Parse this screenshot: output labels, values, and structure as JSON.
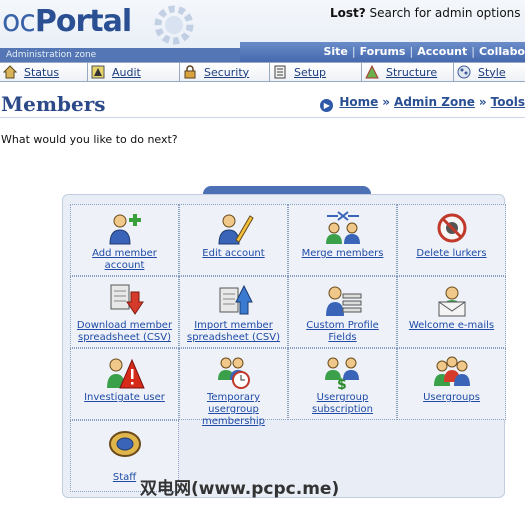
{
  "header": {
    "logo_oc": "oc",
    "logo_portal": "Portal",
    "zone_label": "Administration zone",
    "lost_prefix": "Lost?",
    "lost_text": " Search for admin options he",
    "topnav": [
      "Site",
      "Forums",
      "Account",
      "Collabo"
    ]
  },
  "tabs": [
    {
      "label": "Status",
      "icon": "house-icon",
      "color": "#c7a24a"
    },
    {
      "label": "Audit",
      "icon": "audit-warning-icon",
      "color": "#d8c03a"
    },
    {
      "label": "Security",
      "icon": "security-lock-icon",
      "color": "#d6a13a"
    },
    {
      "label": "Setup",
      "icon": "setup-checklist-icon",
      "color": "#9aa"
    },
    {
      "label": "Structure",
      "icon": "structure-triangle-icon",
      "color": "#5aa04a"
    },
    {
      "label": "Style",
      "icon": "style-palette-icon",
      "color": "#6a7fb0"
    }
  ],
  "page": {
    "title": "Members",
    "breadcrumb": [
      "Home",
      "Admin Zone",
      "Tools"
    ],
    "prompt": "What would you like to do next?"
  },
  "actions": [
    {
      "label": "Add member account",
      "icon": "add-member-icon"
    },
    {
      "label": "Edit account",
      "icon": "edit-account-icon"
    },
    {
      "label": "Merge members",
      "icon": "merge-members-icon"
    },
    {
      "label": "Delete lurkers",
      "icon": "delete-lurkers-icon"
    },
    {
      "label": "Download member spreadsheet (CSV)",
      "icon": "download-csv-icon"
    },
    {
      "label": "Import member spreadsheet (CSV)",
      "icon": "import-csv-icon"
    },
    {
      "label": "Custom Profile Fields",
      "icon": "custom-profile-fields-icon"
    },
    {
      "label": "Welcome e-mails",
      "icon": "welcome-email-icon"
    },
    {
      "label": "Investigate user",
      "icon": "investigate-user-icon"
    },
    {
      "label": "Temporary usergroup membership",
      "icon": "temporary-membership-icon"
    },
    {
      "label": "Usergroup subscription",
      "icon": "usergroup-subscription-icon"
    },
    {
      "label": "Usergroups",
      "icon": "usergroups-icon"
    },
    {
      "label": "Staff",
      "icon": "staff-badge-icon"
    }
  ],
  "watermark": "双电网(www.pcpc.me)"
}
